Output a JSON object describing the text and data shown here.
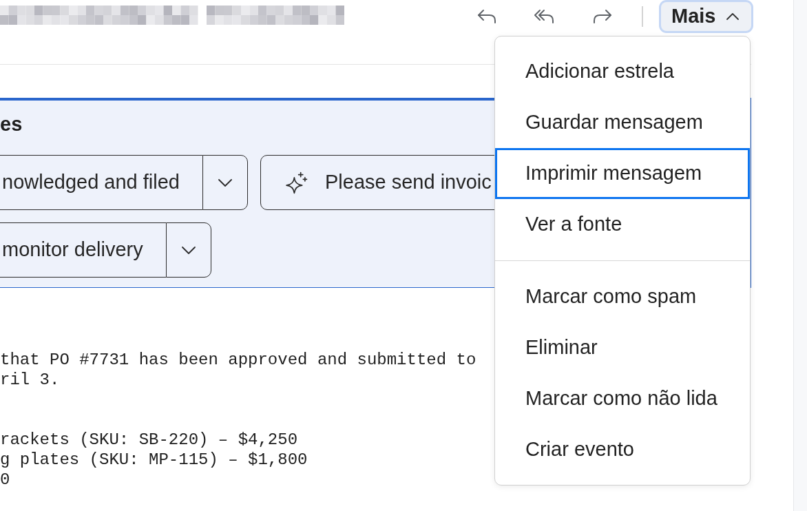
{
  "toolbar": {
    "actions": [
      {
        "kind": "reply"
      },
      {
        "kind": "reply_all"
      },
      {
        "kind": "forward"
      }
    ],
    "more_button": {
      "label": "Mais",
      "expanded": true,
      "focused": true
    }
  },
  "suggestions": {
    "title": "es",
    "rows": [
      [
        {
          "kind": "split",
          "label": "nowledged and filed"
        },
        {
          "kind": "sparkle",
          "label": "Please send invoic"
        }
      ],
      [
        {
          "kind": "split",
          "label": "monitor delivery"
        }
      ]
    ]
  },
  "message_body": {
    "paragraphs": [
      {
        "lines": [
          "that PO #7731 has been approved and submitted to",
          "ril 3."
        ]
      },
      {
        "lines": [
          "rackets (SKU: SB-220) – $4,250",
          "g plates (SKU: MP-115) – $1,800",
          "0"
        ]
      }
    ]
  },
  "menu": {
    "sections": [
      {
        "items": [
          {
            "label": "Adicionar estrela",
            "focused": false
          },
          {
            "label": "Guardar mensagem",
            "focused": false
          },
          {
            "label": "Imprimir mensagem",
            "focused": true
          },
          {
            "label": "Ver a fonte",
            "focused": false
          }
        ]
      },
      {
        "items": [
          {
            "label": "Marcar como spam",
            "focused": false
          },
          {
            "label": "Eliminar",
            "focused": false
          },
          {
            "label": "Marcar como não lida",
            "focused": false
          },
          {
            "label": "Criar evento",
            "focused": false
          }
        ]
      }
    ]
  }
}
